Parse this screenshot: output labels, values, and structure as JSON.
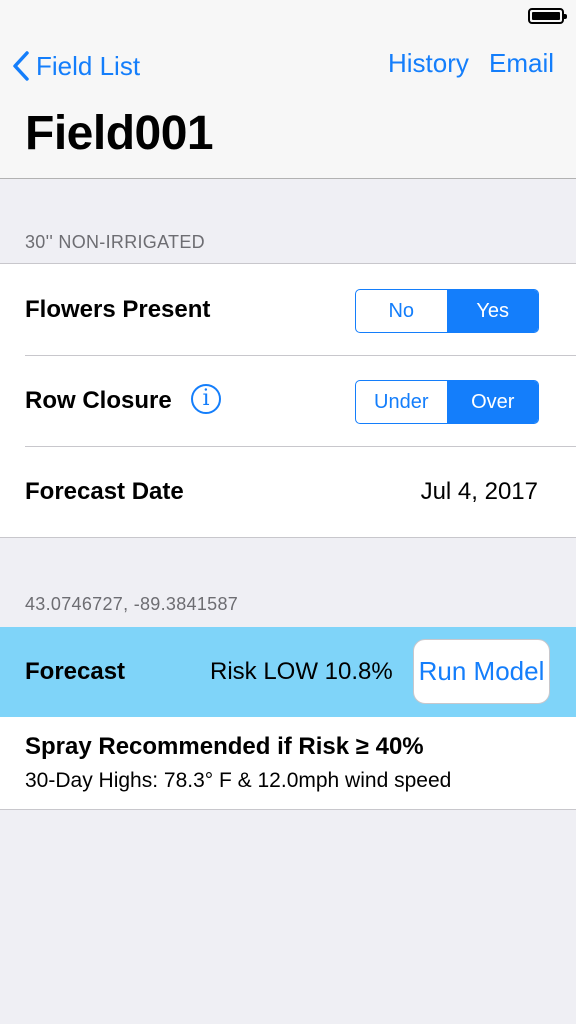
{
  "nav": {
    "back_label": "Field List",
    "history_label": "History",
    "email_label": "Email",
    "title": "Field001"
  },
  "settings": {
    "section_header": "30'' NON-IRRIGATED",
    "flowers": {
      "label": "Flowers Present",
      "options": [
        "No",
        "Yes"
      ],
      "selected": "Yes"
    },
    "row_closure": {
      "label": "Row Closure",
      "options": [
        "Under",
        "Over"
      ],
      "selected": "Over"
    },
    "forecast_date": {
      "label": "Forecast Date",
      "value": "Jul 4, 2017"
    }
  },
  "location": {
    "coordinates": "43.0746727, -89.3841587"
  },
  "forecast": {
    "label": "Forecast",
    "risk": "Risk LOW 10.8%",
    "run_label": "Run Model"
  },
  "spray": {
    "title": "Spray Recommended if Risk ≥ 40%",
    "subtitle": "30-Day Highs: 78.3° F & 12.0mph wind speed"
  },
  "colors": {
    "accent": "#147efb",
    "forecast_bg": "#7fd4f9",
    "page_bg": "#efeff4"
  },
  "icons": {
    "back": "chevron-left-icon",
    "info": "info-icon",
    "battery": "battery-icon"
  }
}
